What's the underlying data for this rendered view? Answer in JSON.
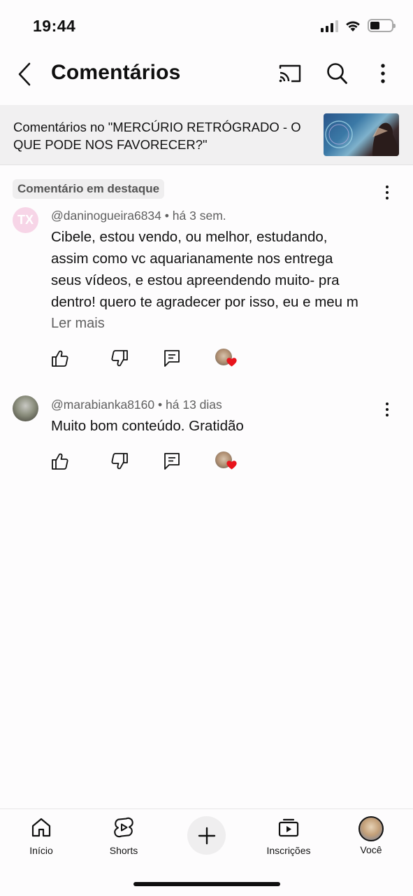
{
  "status_bar": {
    "time": "19:44"
  },
  "header": {
    "title": "Comentários"
  },
  "context": {
    "text": "Comentários no \"MERCÚRIO RETRÓGRADO - O QUE PODE NOS FAVORECER?\""
  },
  "comments": [
    {
      "badge": "Comentário em destaque",
      "avatar_initials": "TX",
      "author": "@daninogueira6834",
      "time": "há 3 sem.",
      "lines": [
        "Cibele, estou vendo, ou melhor, estudando,",
        "assim como vc aquarianamente nos entrega",
        "seus vídeos, e estou apreendendo muito- pra",
        "dentro! quero te agradecer por isso, eu e meu m"
      ],
      "read_more": "Ler mais"
    },
    {
      "author": "@marabianka8160",
      "time": "há 13 dias",
      "lines": [
        "Muito bom conteúdo.  Gratidão"
      ]
    }
  ],
  "separator": "•",
  "bottom_nav": {
    "home": "Início",
    "shorts": "Shorts",
    "subscriptions": "Inscrições",
    "you": "Você"
  },
  "colors": {
    "heart": "#e8141c",
    "text_secondary": "#606060"
  }
}
